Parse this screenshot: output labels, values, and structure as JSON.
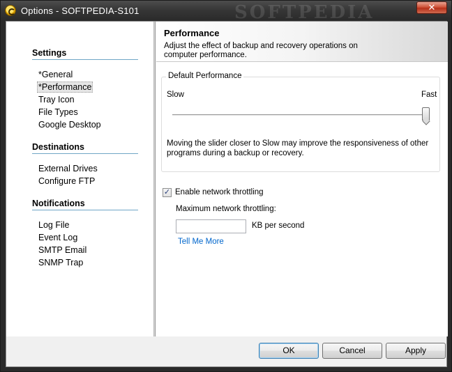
{
  "window": {
    "title": "Options - SOFTPEDIA-S101",
    "watermark": "SOFTPEDIA",
    "close_label": "✕"
  },
  "sidebar": {
    "sections": [
      {
        "title": "Settings",
        "items": [
          "*General",
          "*Performance",
          "Tray Icon",
          "File Types",
          "Google Desktop"
        ]
      },
      {
        "title": "Destinations",
        "items": [
          "External Drives",
          "Configure FTP"
        ]
      },
      {
        "title": "Notifications",
        "items": [
          "Log File",
          "Event Log",
          "SMTP Email",
          "SNMP Trap"
        ]
      }
    ],
    "selected_item": "*Performance"
  },
  "main": {
    "header": {
      "title": "Performance",
      "description": "Adjust the effect of backup and recovery operations on computer performance."
    },
    "default_performance": {
      "legend": "Default Performance",
      "slider_min_label": "Slow",
      "slider_max_label": "Fast",
      "slider_level": 1.0,
      "help_text": "Moving the slider closer to Slow may improve the responsiveness of other programs during a backup or recovery."
    },
    "throttling": {
      "checkbox_label": "Enable network throttling",
      "checked": true,
      "max_label": "Maximum network throttling:",
      "value": "",
      "unit": "KB per second",
      "link": "Tell Me More"
    }
  },
  "footer": {
    "ok_label": "OK",
    "cancel_label": "Cancel",
    "apply_label": "Apply"
  },
  "colors": {
    "section_rule": "#6fa6c6",
    "link": "#0066cc",
    "close_button": "#c8452c"
  }
}
